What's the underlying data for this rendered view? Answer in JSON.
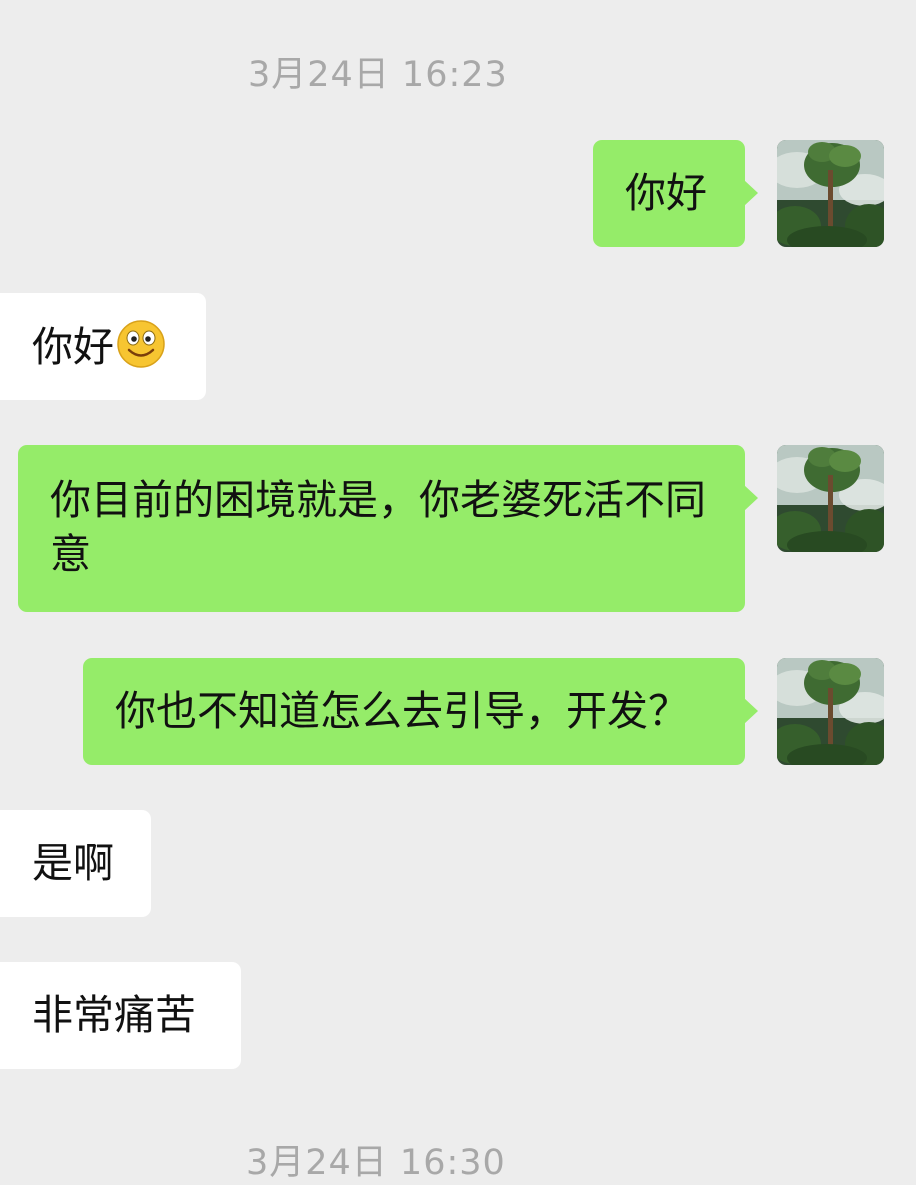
{
  "timestamps": {
    "first": "3月24日 16:23",
    "second": "3月24日 16:30"
  },
  "messages": [
    {
      "side": "outgoing",
      "text": "你好"
    },
    {
      "side": "incoming",
      "text": "你好",
      "emoji": "smile-emoji"
    },
    {
      "side": "outgoing",
      "text": "你目前的困境就是，你老婆死活不同意"
    },
    {
      "side": "outgoing",
      "text": "你也不知道怎么去引导，开发？"
    },
    {
      "side": "incoming",
      "text": "是啊"
    },
    {
      "side": "incoming",
      "text": "非常痛苦"
    }
  ],
  "colors": {
    "background": "#ededed",
    "outgoing_bubble": "#95ec69",
    "incoming_bubble": "#ffffff",
    "timestamp_text": "#a8a8a8",
    "message_text": "#111111"
  },
  "icons": {
    "avatar": "forest-tree-avatar-icon",
    "emoji": "smile-emoji-icon"
  }
}
